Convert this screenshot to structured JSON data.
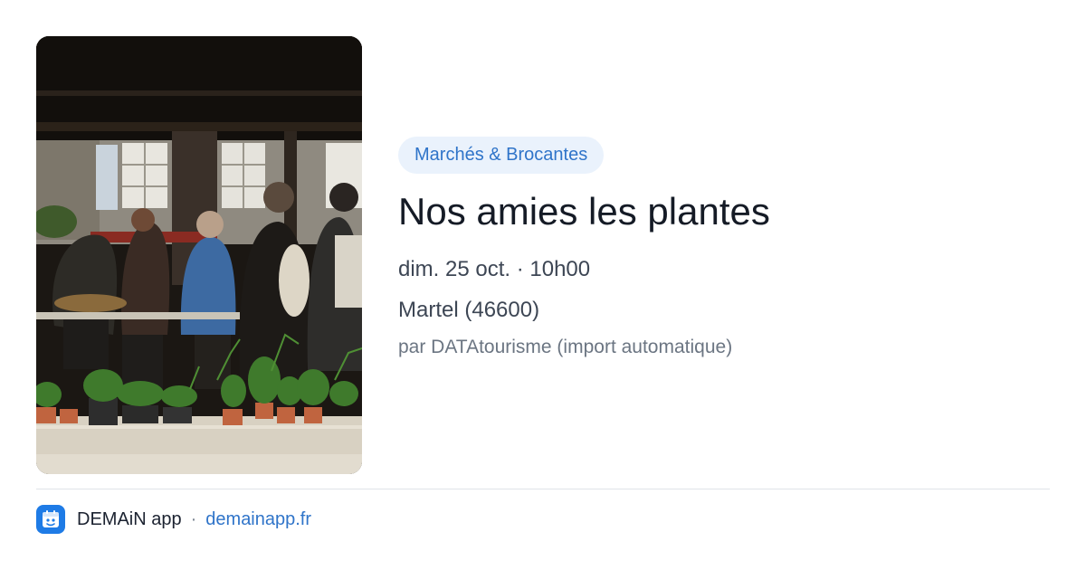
{
  "event": {
    "category": "Marchés & Brocantes",
    "title": "Nos amies les plantes",
    "date": "dim. 25 oct. · 10h00",
    "location": "Martel (46600)",
    "author": "par DATAtourisme (import automatique)"
  },
  "photo": {
    "description_icon": "market-photo"
  },
  "footer": {
    "app_name": "DEMAiN app",
    "separator": "·",
    "site": "demainapp.fr"
  },
  "colors": {
    "accent": "#2f74c9",
    "badge_bg": "#eaf2fc",
    "app_icon_bg": "#1e7be6",
    "title": "#151b26",
    "body": "#3d4654",
    "muted": "#6b7582"
  }
}
